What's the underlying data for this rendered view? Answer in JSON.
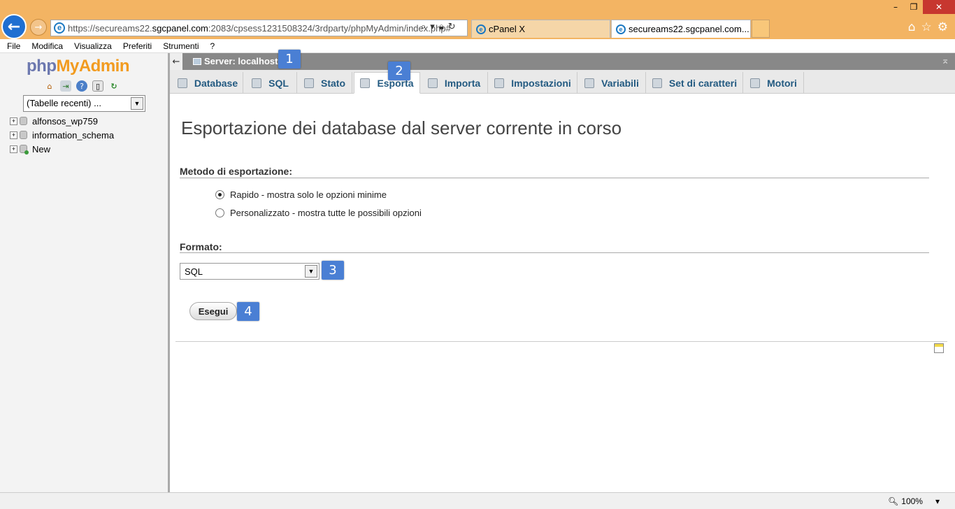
{
  "browser": {
    "url_prefix": "https://secureams22.",
    "url_host": "sgcpanel.com",
    "url_rest": ":2083/cpsess1231508324/3rdparty/phpMyAdmin/index.php#",
    "tabs": [
      {
        "label": "cPanel X"
      },
      {
        "label": "secureams22.sgcpanel.com..."
      }
    ],
    "tab_close": "×",
    "zoom": "100%"
  },
  "menu": [
    "File",
    "Modifica",
    "Visualizza",
    "Preferiti",
    "Strumenti",
    "?"
  ],
  "sidebar": {
    "logo_php": "php",
    "logo_my": "My",
    "logo_admin": "Admin",
    "recent_select": "(Tabelle recenti) ...",
    "databases": [
      {
        "name": "alfonsos_wp759"
      },
      {
        "name": "information_schema"
      },
      {
        "name": "New"
      }
    ]
  },
  "server": {
    "label": "Server: localhost"
  },
  "tabs": [
    {
      "label": "Database"
    },
    {
      "label": "SQL"
    },
    {
      "label": "Stato"
    },
    {
      "label": "Esporta"
    },
    {
      "label": "Importa"
    },
    {
      "label": "Impostazioni"
    },
    {
      "label": "Variabili"
    },
    {
      "label": "Set di caratteri"
    },
    {
      "label": "Motori"
    }
  ],
  "main": {
    "title": "Esportazione dei database dal server corrente in corso",
    "method_label": "Metodo di esportazione:",
    "method_options": [
      {
        "label": "Rapido - mostra solo le opzioni minime",
        "selected": true
      },
      {
        "label": "Personalizzato - mostra tutte le possibili opzioni",
        "selected": false
      }
    ],
    "format_label": "Formato:",
    "format_value": "SQL",
    "go_button": "Esegui"
  },
  "badges": [
    "1",
    "2",
    "3",
    "4"
  ],
  "colors": {
    "titlebar": "#f3b463",
    "tab_text": "#235a81",
    "badge": "#4a7fd4"
  }
}
